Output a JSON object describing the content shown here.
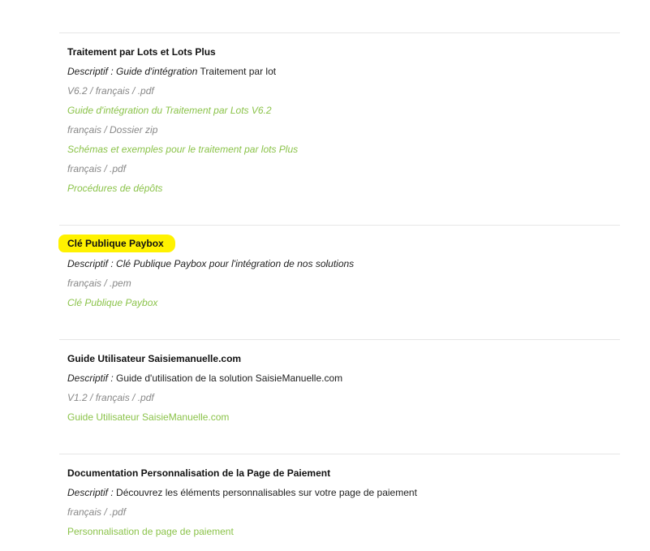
{
  "sections": [
    {
      "title": "Traitement par Lots et Lots Plus",
      "desc_key": "Descriptif :",
      "desc_mid_italic": "Guide d'intégration",
      "desc_value": "Traitement par lot",
      "items": [
        {
          "meta": "V6.2 / français / .pdf",
          "link": "Guide d'intégration du Traitement par Lots V6.2"
        },
        {
          "meta": "français / Dossier zip",
          "link": "Schémas et exemples pour le traitement par lots Plus"
        },
        {
          "meta": "français / .pdf",
          "link": "Procédures de dépôts"
        }
      ]
    },
    {
      "title": "Clé Publique Paybox",
      "desc_key": "Descriptif :",
      "desc_value": "Clé Publique Paybox pour l'intégration de nos solutions",
      "items": [
        {
          "meta": "français / .pem",
          "link": "Clé Publique Paybox"
        }
      ]
    },
    {
      "title": "Guide Utilisateur Saisiemanuelle.com",
      "desc_key": "Descriptif :",
      "desc_value": "Guide d'utilisation de la solution SaisieManuelle.com",
      "items": [
        {
          "meta": "V1.2 / français / .pdf",
          "link": "Guide Utilisateur SaisieManuelle.com"
        }
      ]
    },
    {
      "title": "Documentation Personnalisation de la Page de Paiement",
      "desc_key": "Descriptif :",
      "desc_value": "Découvrez les éléments personnalisables sur votre page de paiement",
      "items": [
        {
          "meta": "français / .pdf",
          "link": "Personnalisation de page de paiement"
        }
      ]
    }
  ],
  "colors": {
    "link": "#8bc34a",
    "highlight": "#fff200",
    "divider": "#e6e6e6",
    "meta": "#888888"
  }
}
